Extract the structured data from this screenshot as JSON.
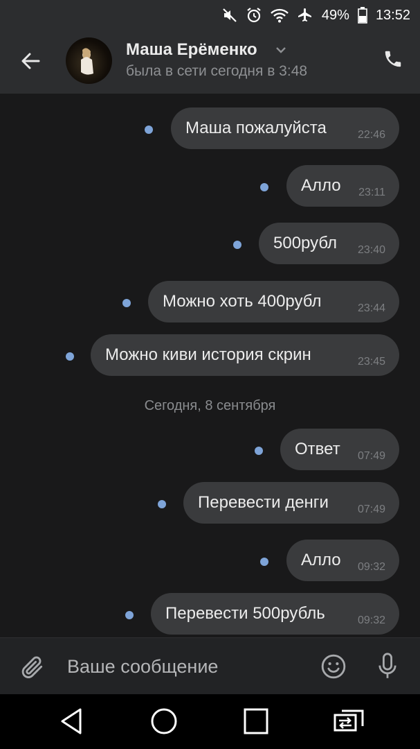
{
  "status_bar": {
    "battery": "49%",
    "time": "13:52"
  },
  "header": {
    "name": "Маша Ерёменко",
    "status": "была в сети сегодня в 3:48"
  },
  "messages_before": [
    {
      "text": "Маша пожалуйста",
      "time": "22:46"
    },
    {
      "text": "Алло",
      "time": "23:11"
    },
    {
      "text": "500рубл",
      "time": "23:40"
    },
    {
      "text": "Можно хоть 400рубл",
      "time": "23:44"
    },
    {
      "text": "Можно киви история скрин",
      "time": "23:45"
    }
  ],
  "date_separator": "Сегодня, 8 сентября",
  "messages_after": [
    {
      "text": "Ответ",
      "time": "07:49"
    },
    {
      "text": "Перевести денги",
      "time": "07:49"
    },
    {
      "text": "Алло",
      "time": "09:32"
    },
    {
      "text": "Перевести 500рубль",
      "time": "09:32"
    }
  ],
  "composer": {
    "placeholder": "Ваше сообщение"
  },
  "colors": {
    "bubble": "#3a3b3d",
    "unread_dot": "#7ea4d8",
    "background": "#19191a",
    "bar": "#2c2d2f"
  },
  "icons": {
    "status": [
      "mute-icon",
      "alarm-icon",
      "wifi-icon",
      "airplane-icon",
      "battery-icon"
    ],
    "header": [
      "back-arrow-icon",
      "chevron-down-icon",
      "phone-icon"
    ],
    "composer": [
      "paperclip-icon",
      "emoji-icon",
      "microphone-icon"
    ],
    "nav": [
      "nav-back-icon",
      "nav-home-icon",
      "nav-recents-icon",
      "nav-switch-icon"
    ]
  }
}
